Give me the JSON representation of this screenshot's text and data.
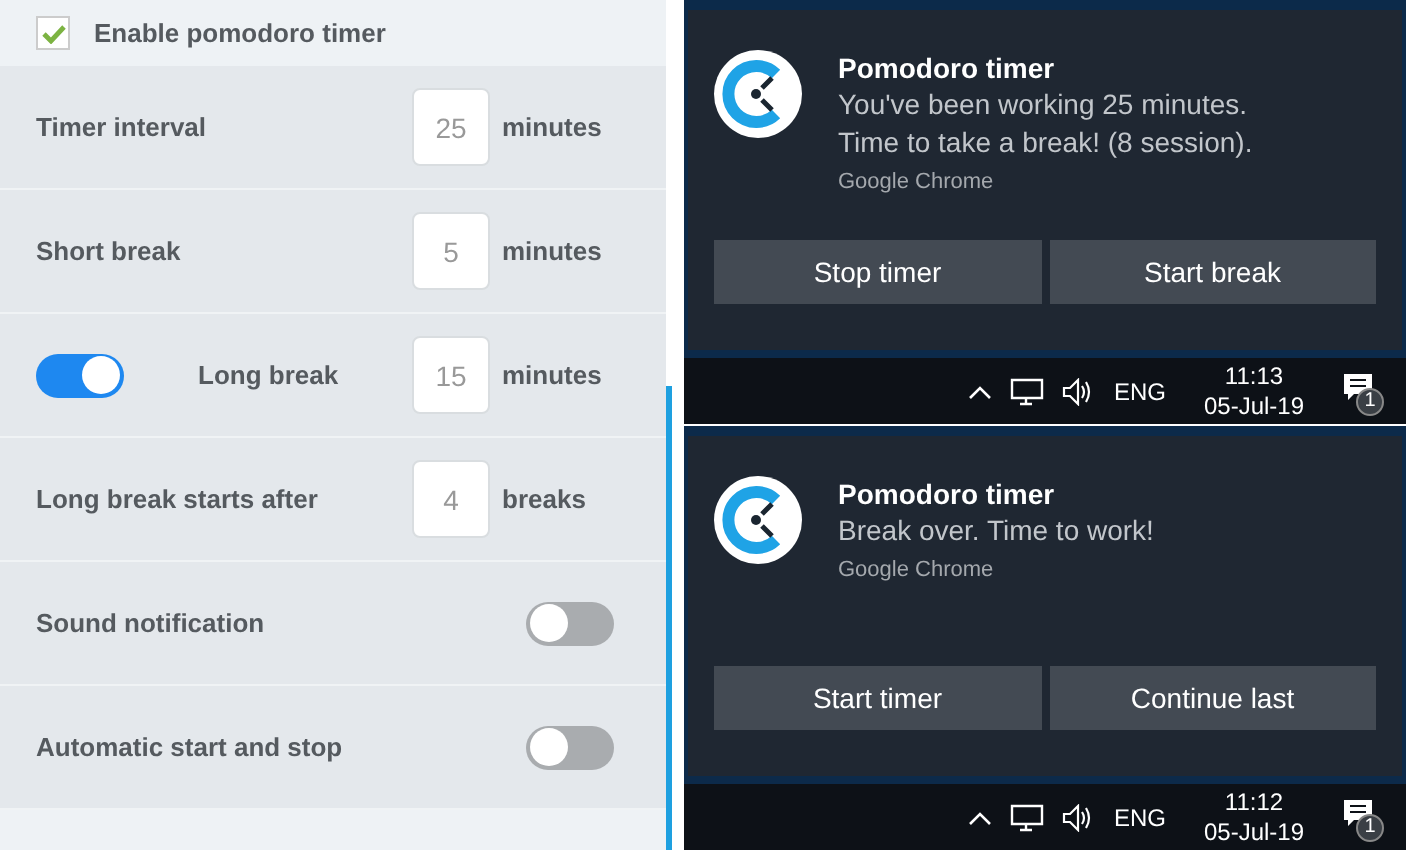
{
  "settings": {
    "enable": {
      "label": "Enable pomodoro timer",
      "checked": true
    },
    "rows": [
      {
        "kind": "number",
        "label": "Timer interval",
        "value": "25",
        "unit": "minutes"
      },
      {
        "kind": "number",
        "label": "Short break",
        "value": "5",
        "unit": "minutes"
      },
      {
        "kind": "number",
        "label": "Long break",
        "value": "15",
        "unit": "minutes",
        "on": true
      },
      {
        "kind": "number",
        "label": "Long break starts after",
        "value": "4",
        "unit": "breaks"
      },
      {
        "kind": "switch",
        "label": "Sound notification",
        "on": false
      },
      {
        "kind": "switch",
        "label": "Automatic start and stop",
        "on": false
      }
    ]
  },
  "notifications": [
    {
      "title": "Pomodoro timer",
      "message": [
        "You've been working 25 minutes.",
        "Time to take a break! (8 session)."
      ],
      "source": "Google Chrome",
      "buttons": [
        "Stop timer",
        "Start break"
      ],
      "taskbar": {
        "language": "ENG",
        "time": "11:13",
        "date": "05-Jul-19",
        "badge": "1"
      }
    },
    {
      "title": "Pomodoro timer",
      "message": [
        "Break over. Time to work!"
      ],
      "source": "Google Chrome",
      "buttons": [
        "Start timer",
        "Continue last"
      ],
      "taskbar": {
        "language": "ENG",
        "time": "11:12",
        "date": "05-Jul-19",
        "badge": "1"
      }
    }
  ]
}
